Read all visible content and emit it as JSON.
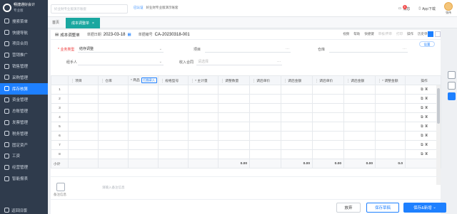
{
  "app": {
    "name": "畅捷通好会计",
    "edition": "专业版"
  },
  "sidebar": {
    "items": [
      {
        "label": "搜索菜单"
      },
      {
        "label": "快捷导航"
      },
      {
        "label": "项目合同"
      },
      {
        "label": "营销推广"
      },
      {
        "label": "销售管理"
      },
      {
        "label": "采购管理"
      },
      {
        "label": "库存核算"
      },
      {
        "label": "资金管理"
      },
      {
        "label": "总账管理"
      },
      {
        "label": "发票管理"
      },
      {
        "label": "税务管理"
      },
      {
        "label": "固定资产"
      },
      {
        "label": "工资"
      },
      {
        "label": "经营管理"
      },
      {
        "label": "智能报表"
      }
    ],
    "active_index": 6,
    "footer": "返回旧版"
  },
  "topbar": {
    "search_placeholder": "好业财专业版演示账套",
    "notice_tag": "已认证",
    "notice_text": "好业财专业版演示账套",
    "messages_label": "消息",
    "messages_count": "5",
    "app_label": "App下载",
    "user_label": "张伟"
  },
  "tabs": {
    "home": "首页",
    "active": "成本调整单",
    "close": "×"
  },
  "toolbar": {
    "title": "成本调整单",
    "date_label": "单据日期",
    "date_value": "2023-03-18",
    "code_label": "单据编号",
    "code_value": "CA-20230318-001",
    "actions": [
      "视频",
      "帮助",
      "快捷键",
      "审核/弃审",
      "打印",
      "操作",
      "历史单据"
    ],
    "dim_actions": [
      3,
      4
    ]
  },
  "form": {
    "business_type_label": "* 业务类型",
    "business_type_value": "结存调整",
    "project_label": "项目",
    "warehouse_label": "仓库",
    "handler_label": "经手人",
    "contract_label": "收入合同",
    "contract_placeholder": "请选择",
    "settings_btn": "设置"
  },
  "grid": {
    "headers": [
      "",
      "项目",
      "仓库",
      "* 商品",
      "规格型号",
      "* 主计量",
      "调整数量",
      "调后单价",
      "调后金额",
      "调后单价",
      "调后金额",
      "* 调整金额",
      "操作"
    ],
    "quick_input": "扫描录入",
    "rows": [
      "1",
      "2",
      "3",
      "4",
      "5",
      "6",
      "7",
      "8"
    ],
    "summary_label": "小计",
    "summary_values": [
      "0.00",
      "0.00",
      "0.00",
      "0.00",
      "0.0"
    ]
  },
  "notes": {
    "label": "备注信息",
    "placeholder": "请输入备注信息"
  },
  "buttons": {
    "giveup": "放弃",
    "draft": "保存草稿",
    "save_new": "保存&新增"
  }
}
